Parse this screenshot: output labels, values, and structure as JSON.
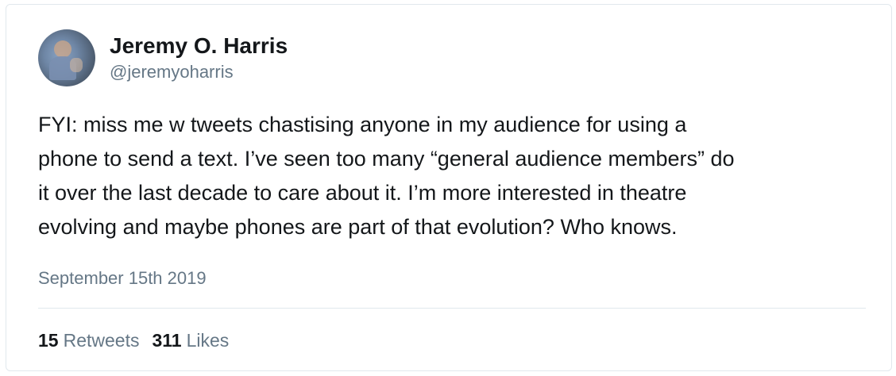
{
  "tweet": {
    "author": {
      "display_name": "Jeremy O. Harris",
      "handle": "@jeremyoharris",
      "avatar_icon": "profile-photo"
    },
    "text_lines": [
      "FYI: miss me w tweets chastising anyone in my audience for using a",
      "phone to send a text. I’ve seen too many “general audience members” do",
      "it over the last decade to care about it. I’m more interested in theatre",
      "evolving and maybe phones are part of that evolution? Who knows."
    ],
    "date": "September 15th 2019",
    "stats": {
      "retweets_count": "15",
      "retweets_label": "Retweets",
      "likes_count": "311",
      "likes_label": "Likes"
    }
  },
  "colors": {
    "text_primary": "#14171a",
    "text_secondary": "#657786",
    "border": "#e1e8ed"
  }
}
